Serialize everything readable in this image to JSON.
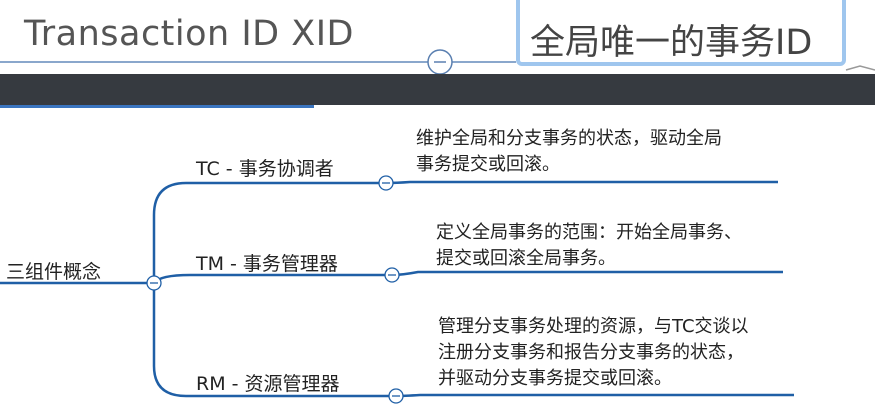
{
  "header": {
    "title": "Transaction ID XID",
    "selected_node": "全局唯一的事务ID"
  },
  "mindmap": {
    "root": "三组件概念",
    "branches": [
      {
        "label": "TC - 事务协调者",
        "lines": [
          "维护全局和分支事务的状态，驱动全局",
          "事务提交或回滚。"
        ]
      },
      {
        "label": "TM - 事务管理器",
        "lines": [
          "定义全局事务的范围：开始全局事务、",
          "提交或回滚全局事务。"
        ]
      },
      {
        "label": "RM - 资源管理器",
        "lines": [
          "管理分支事务处理的资源，与TC交谈以",
          "注册分支事务和报告分支事务的状态，",
          "并驱动分支事务提交或回滚。"
        ]
      }
    ]
  },
  "colors": {
    "line": "#1f5fa6",
    "dark_bar": "#363a40",
    "selection": "#9fc6ee"
  }
}
